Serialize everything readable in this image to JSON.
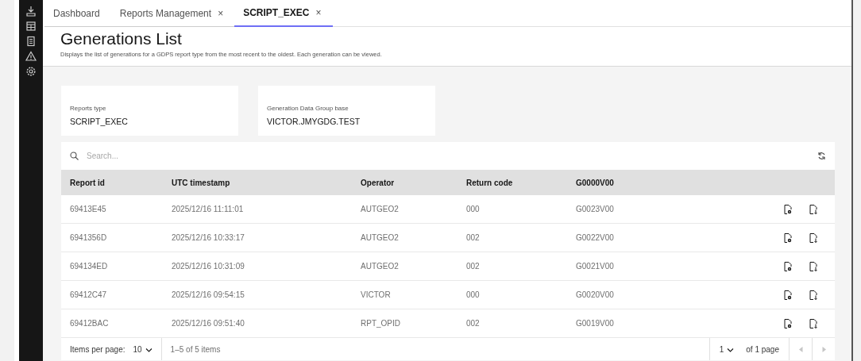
{
  "sidebar": {
    "items": [
      {
        "kind": "download"
      },
      {
        "kind": "table"
      },
      {
        "kind": "list"
      },
      {
        "kind": "warning"
      },
      {
        "kind": "settings"
      }
    ]
  },
  "tabs": [
    {
      "label": "Dashboard",
      "selected": false
    },
    {
      "label": "Reports Management",
      "selected": false,
      "close": "×"
    },
    {
      "label": "SCRIPT_EXEC",
      "selected": true,
      "close": "×"
    }
  ],
  "header": {
    "title": "Generations List",
    "description": "Displays the list of generations for a GDPS report type from the most recent to the oldest. Each generation can be viewed."
  },
  "info_cards": [
    {
      "label": "Reports type",
      "value": "SCRIPT_EXEC"
    },
    {
      "label": "Generation Data Group base",
      "value": "VICTOR.JMYGDG.TEST"
    }
  ],
  "search": {
    "placeholder": "Search..."
  },
  "table": {
    "columns": [
      "Report id",
      "UTC timestamp",
      "Operator",
      "Return code",
      "G0000V00"
    ],
    "rows": [
      [
        "69413E45",
        "2025/12/16 11:11:01",
        "AUTGEO2",
        "000",
        "G0023V00"
      ],
      [
        "6941356D",
        "2025/12/16 10:33:17",
        "AUTGEO2",
        "002",
        "G0022V00"
      ],
      [
        "694134ED",
        "2025/12/16 10:31:09",
        "AUTGEO2",
        "002",
        "G0021V00"
      ],
      [
        "69412C47",
        "2025/12/16 09:54:15",
        "VICTOR",
        "000",
        "G0020V00"
      ],
      [
        "69412BAC",
        "2025/12/16 09:51:40",
        "RPT_OPID",
        "002",
        "G0019V00"
      ]
    ]
  },
  "pagination": {
    "items_per_page_label": "Items per page:",
    "page_size": "10",
    "range": "1–5 of 5 items",
    "page": "1",
    "page_total": "of 1 page"
  }
}
